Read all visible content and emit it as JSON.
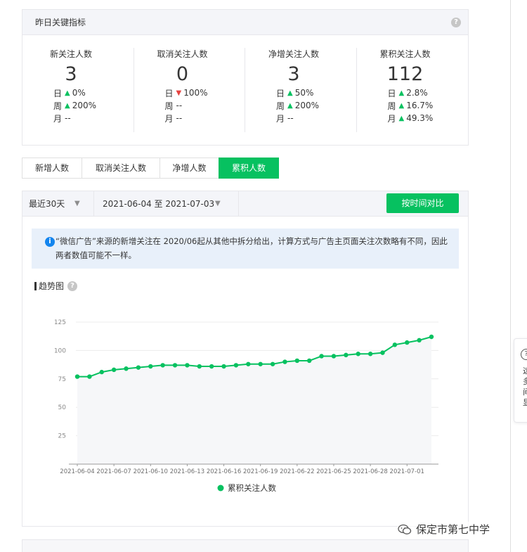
{
  "metrics_panel": {
    "title": "昨日关键指标",
    "help": "?",
    "items": [
      {
        "label": "新关注人数",
        "value": "3",
        "rows": [
          {
            "k": "日",
            "dir": "up",
            "v": "0%"
          },
          {
            "k": "周",
            "dir": "up",
            "v": "200%"
          },
          {
            "k": "月",
            "dir": "",
            "v": "--"
          }
        ]
      },
      {
        "label": "取消关注人数",
        "value": "0",
        "rows": [
          {
            "k": "日",
            "dir": "down",
            "v": "100%"
          },
          {
            "k": "周",
            "dir": "",
            "v": "--"
          },
          {
            "k": "月",
            "dir": "",
            "v": "--"
          }
        ]
      },
      {
        "label": "净增关注人数",
        "value": "3",
        "rows": [
          {
            "k": "日",
            "dir": "up",
            "v": "50%"
          },
          {
            "k": "周",
            "dir": "up",
            "v": "200%"
          },
          {
            "k": "月",
            "dir": "",
            "v": "--"
          }
        ]
      },
      {
        "label": "累积关注人数",
        "value": "112",
        "rows": [
          {
            "k": "日",
            "dir": "up",
            "v": "2.8%"
          },
          {
            "k": "周",
            "dir": "up",
            "v": "16.7%"
          },
          {
            "k": "月",
            "dir": "up",
            "v": "49.3%"
          }
        ]
      }
    ]
  },
  "tabs": [
    {
      "label": "新增人数",
      "active": false
    },
    {
      "label": "取消关注人数",
      "active": false
    },
    {
      "label": "净增人数",
      "active": false
    },
    {
      "label": "累积人数",
      "active": true
    }
  ],
  "filters": {
    "period": "最近30天",
    "date_range": "2021-06-04 至 2021-07-03",
    "compare_button": "按时间对比"
  },
  "notice": {
    "icon": "i",
    "text": "“微信广告”来源的新增关注在 2020/06起从其他中拆分给出，计算方式与广告主页面关注次数略有不同，因此两者数值可能不一样。"
  },
  "trend": {
    "title": "趋势图",
    "help": "?"
  },
  "colors": {
    "accent": "#07c160",
    "up": "#07c160",
    "down": "#e64340",
    "info": "#1485ee"
  },
  "chart_data": {
    "type": "line",
    "title": "",
    "xlabel": "",
    "ylabel": "",
    "ylim": [
      0,
      125
    ],
    "yticks": [
      25,
      50,
      75,
      100,
      125
    ],
    "xtick_labels": [
      "2021-06-04",
      "2021-06-07",
      "2021-06-10",
      "2021-06-13",
      "2021-06-16",
      "2021-06-19",
      "2021-06-22",
      "2021-06-25",
      "2021-06-28",
      "2021-07-01"
    ],
    "legend_position": "bottom",
    "x": [
      "2021-06-04",
      "2021-06-05",
      "2021-06-06",
      "2021-06-07",
      "2021-06-08",
      "2021-06-09",
      "2021-06-10",
      "2021-06-11",
      "2021-06-12",
      "2021-06-13",
      "2021-06-14",
      "2021-06-15",
      "2021-06-16",
      "2021-06-17",
      "2021-06-18",
      "2021-06-19",
      "2021-06-20",
      "2021-06-21",
      "2021-06-22",
      "2021-06-23",
      "2021-06-24",
      "2021-06-25",
      "2021-06-26",
      "2021-06-27",
      "2021-06-28",
      "2021-06-29",
      "2021-06-30",
      "2021-07-01",
      "2021-07-02",
      "2021-07-03"
    ],
    "series": [
      {
        "name": "累积关注人数",
        "values": [
          77,
          77,
          81,
          83,
          84,
          85,
          86,
          87,
          87,
          87,
          86,
          86,
          86,
          87,
          88,
          88,
          88,
          90,
          91,
          91,
          95,
          95,
          96,
          97,
          97,
          98,
          105,
          107,
          109,
          112
        ]
      }
    ]
  },
  "side_popup": {
    "icon": "?",
    "chars": [
      "这",
      "多",
      "间",
      "显"
    ]
  },
  "watermark": {
    "text": "保定市第七中学"
  }
}
